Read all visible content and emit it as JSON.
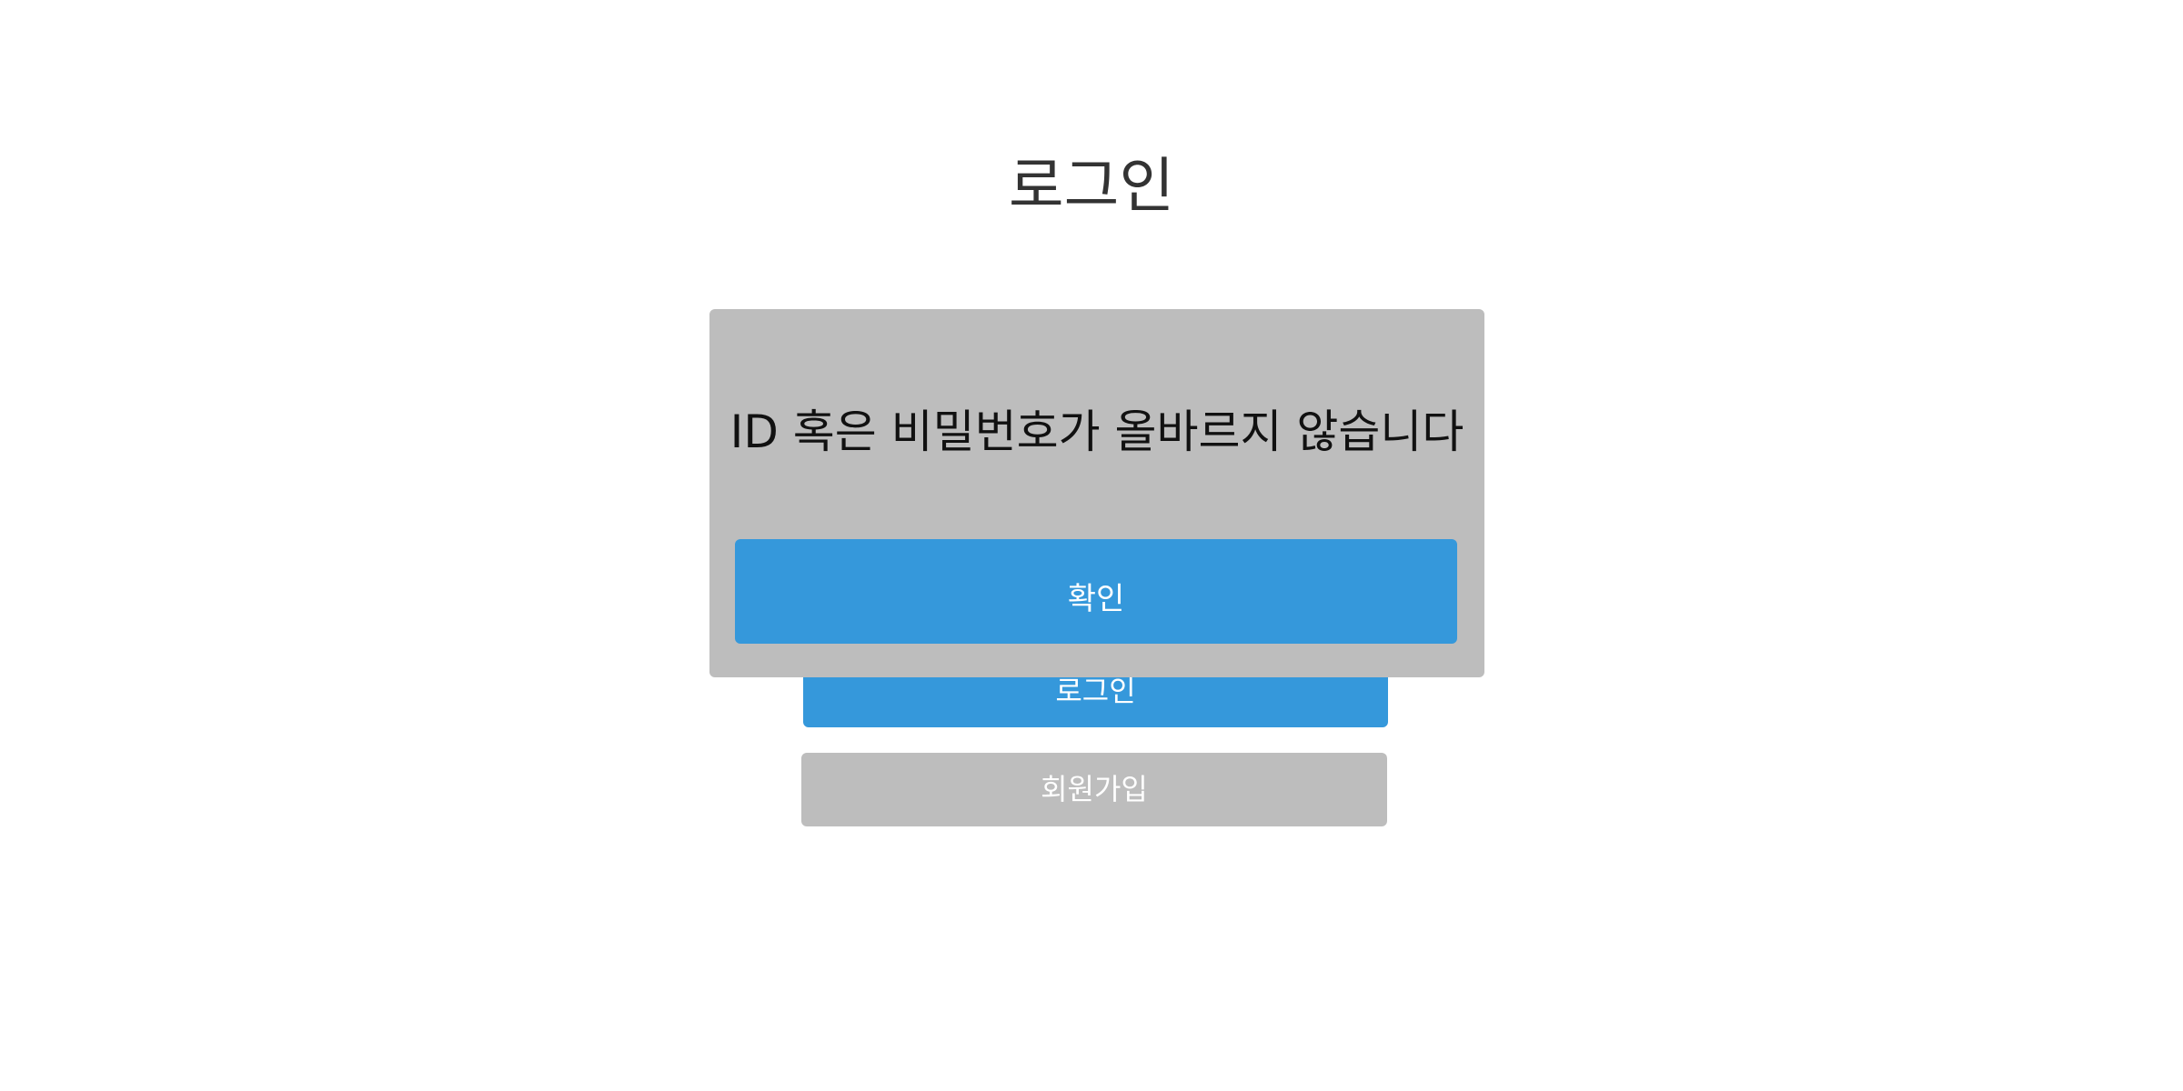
{
  "page": {
    "title": "로그인"
  },
  "buttons": {
    "login_label": "로그인",
    "signup_label": "회원가입"
  },
  "modal": {
    "message": "ID 혹은 비밀번호가 올바르지 않습니다",
    "confirm_label": "확인"
  },
  "colors": {
    "primary": "#3598db",
    "secondary": "#bdbdbd",
    "modal_background": "#bdbdbd",
    "title_text": "#333333",
    "button_text": "#ffffff"
  }
}
